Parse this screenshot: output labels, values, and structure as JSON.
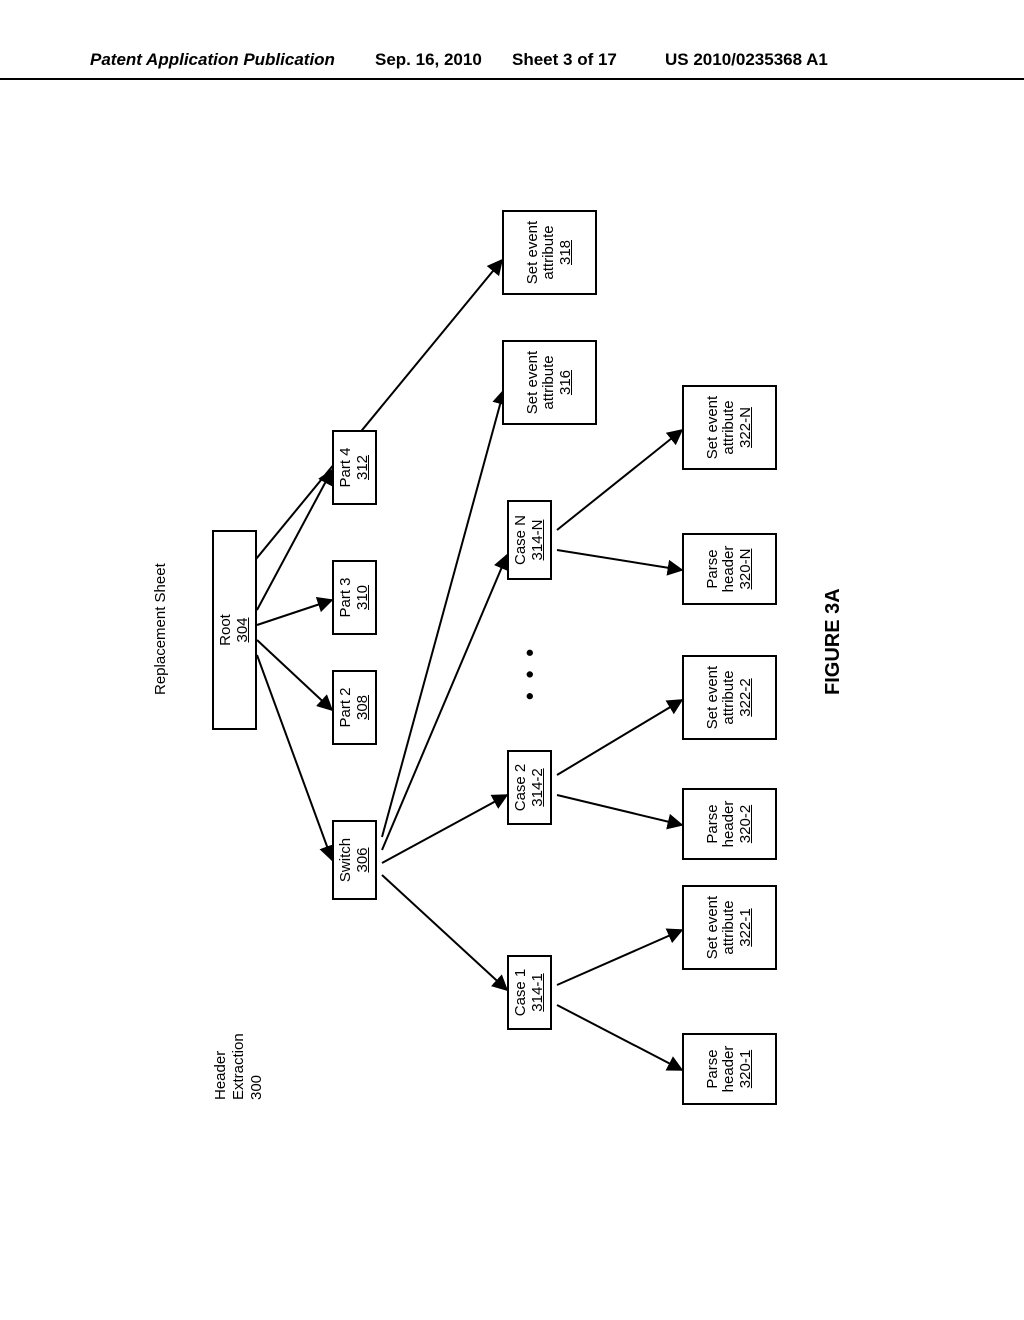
{
  "header": {
    "left": "Patent Application Publication",
    "date": "Sep. 16, 2010",
    "sheet": "Sheet 3 of 17",
    "pubno": "US 2010/0235368 A1"
  },
  "sheet_label": "Replacement Sheet",
  "figure_caption": "FIGURE 3A",
  "annotations": {
    "header_extraction": "Header\nExtraction\n300"
  },
  "nodes": {
    "root": {
      "label": "Root",
      "ref": "304"
    },
    "switch": {
      "label": "Switch",
      "ref": "306"
    },
    "part2": {
      "label": "Part 2",
      "ref": "308"
    },
    "part3": {
      "label": "Part 3",
      "ref": "310"
    },
    "part4": {
      "label": "Part 4",
      "ref": "312"
    },
    "case1": {
      "label": "Case 1",
      "ref": "314-1"
    },
    "case2": {
      "label": "Case 2",
      "ref": "314-2"
    },
    "caseN": {
      "label": "Case N",
      "ref": "314-N"
    },
    "sea316": {
      "label": "Set event\nattribute",
      "ref": "316"
    },
    "sea318": {
      "label": "Set event\nattribute",
      "ref": "318"
    },
    "ph1": {
      "label": "Parse\nheader",
      "ref": "320-1"
    },
    "sea1": {
      "label": "Set event\nattribute",
      "ref": "322-1"
    },
    "ph2": {
      "label": "Parse\nheader",
      "ref": "320-2"
    },
    "sea2": {
      "label": "Set event\nattribute",
      "ref": "322-2"
    },
    "phN": {
      "label": "Parse\nheader",
      "ref": "320-N"
    },
    "seaN": {
      "label": "Set event\nattribute",
      "ref": "322-N"
    }
  }
}
